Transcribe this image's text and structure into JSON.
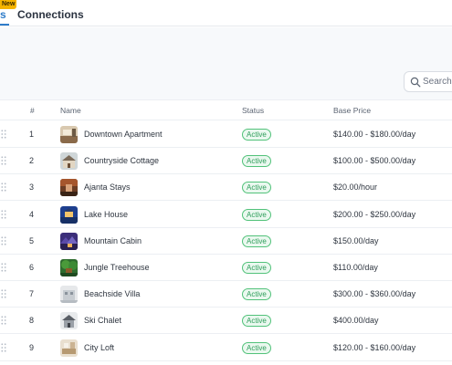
{
  "tabs": {
    "active_label": "s",
    "new_badge": "New",
    "connections_label": "Connections"
  },
  "search": {
    "placeholder": "Search"
  },
  "table": {
    "headers": {
      "index": "#",
      "name": "Name",
      "status": "Status",
      "price": "Base Price"
    },
    "rows": [
      {
        "index": "1",
        "name": "Downtown Apartment",
        "status": "Active",
        "price": "$140.00 - $180.00/day",
        "thumb": "apartment-photo"
      },
      {
        "index": "2",
        "name": "Countryside Cottage",
        "status": "Active",
        "price": "$100.00 - $500.00/day",
        "thumb": "cottage-photo"
      },
      {
        "index": "3",
        "name": "Ajanta Stays",
        "status": "Active",
        "price": "$20.00/hour",
        "thumb": "stays-photo"
      },
      {
        "index": "4",
        "name": "Lake House",
        "status": "Active",
        "price": "$200.00 - $250.00/day",
        "thumb": "lake-house-photo"
      },
      {
        "index": "5",
        "name": "Mountain Cabin",
        "status": "Active",
        "price": "$150.00/day",
        "thumb": "cabin-photo"
      },
      {
        "index": "6",
        "name": "Jungle Treehouse",
        "status": "Active",
        "price": "$110.00/day",
        "thumb": "treehouse-photo"
      },
      {
        "index": "7",
        "name": "Beachside Villa",
        "status": "Active",
        "price": "$300.00 - $360.00/day",
        "thumb": "villa-photo"
      },
      {
        "index": "8",
        "name": "Ski Chalet",
        "status": "Active",
        "price": "$400.00/day",
        "thumb": "chalet-photo"
      },
      {
        "index": "9",
        "name": "City Loft",
        "status": "Active",
        "price": "$120.00 - $160.00/day",
        "thumb": "loft-photo"
      }
    ]
  },
  "colors": {
    "accent": "#2f7cc9",
    "status_green": "#2f9e5b",
    "badge_yellow": "#f5b400"
  }
}
